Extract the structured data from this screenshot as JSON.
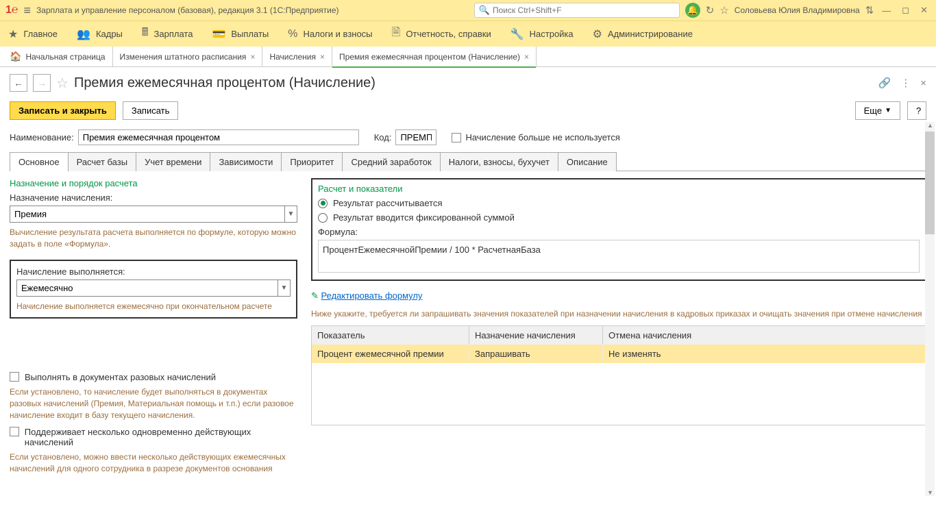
{
  "top": {
    "app_title": "Зарплата и управление персоналом (базовая), редакция 3.1  (1С:Предприятие)",
    "search_placeholder": "Поиск Ctrl+Shift+F",
    "user": "Соловьева Юлия Владимировна"
  },
  "menu": [
    {
      "label": "Главное"
    },
    {
      "label": "Кадры"
    },
    {
      "label": "Зарплата"
    },
    {
      "label": "Выплаты"
    },
    {
      "label": "Налоги и взносы"
    },
    {
      "label": "Отчетность, справки"
    },
    {
      "label": "Настройка"
    },
    {
      "label": "Администрирование"
    }
  ],
  "tabs": [
    {
      "label": "Начальная страница",
      "closable": false
    },
    {
      "label": "Изменения штатного расписания",
      "closable": true
    },
    {
      "label": "Начисления",
      "closable": true
    },
    {
      "label": "Премия ежемесячная процентом (Начисление)",
      "closable": true,
      "active": true
    }
  ],
  "page": {
    "title": "Премия ежемесячная процентом (Начисление)"
  },
  "toolbar": {
    "save_close": "Записать и закрыть",
    "save": "Записать",
    "more": "Еще",
    "help": "?"
  },
  "form": {
    "name_label": "Наименование:",
    "name_value": "Премия ежемесячная процентом",
    "code_label": "Код:",
    "code_value": "ПРЕМП",
    "not_used_label": "Начисление больше не используется"
  },
  "ctabs": [
    "Основное",
    "Расчет базы",
    "Учет времени",
    "Зависимости",
    "Приоритет",
    "Средний заработок",
    "Налоги, взносы, бухучет",
    "Описание"
  ],
  "left": {
    "section1": "Назначение и порядок расчета",
    "assign_label": "Назначение начисления:",
    "assign_value": "Премия",
    "assign_hint": "Вычисление результата расчета выполняется по формуле, которую можно задать в поле «Формула».",
    "perform_label": "Начисление выполняется:",
    "perform_value": "Ежемесячно",
    "perform_hint": "Начисление выполняется ежемесячно при окончательном расчете",
    "cb1_label": "Выполнять в документах разовых начислений",
    "cb1_hint": "Если установлено, то начисление будет выполняться в документах разовых начислений (Премия, Материальная помощь и т.п.) если разовое начисление входит в базу текущего начисления.",
    "cb2_label": "Поддерживает несколько одновременно действующих начислений",
    "cb2_hint": "Если установлено, можно ввести несколько действующих ежемесячных начислений для одного сотрудника в разрезе документов основания"
  },
  "right": {
    "section": "Расчет и показатели",
    "radio1": "Результат рассчитывается",
    "radio2": "Результат вводится фиксированной суммой",
    "formula_label": "Формула:",
    "formula": "ПроцентЕжемесячнойПремии / 100 * РасчетнаяБаза",
    "edit_link": "Редактировать формулу",
    "hint": "Ниже укажите, требуется ли запрашивать значения показателей при назначении начисления в кадровых приказах и очищать значения при отмене начисления",
    "table": {
      "h1": "Показатель",
      "h2": "Назначение начисления",
      "h3": "Отмена начисления",
      "r1c1": "Процент ежемесячной премии",
      "r1c2": "Запрашивать",
      "r1c3": "Не изменять"
    }
  }
}
